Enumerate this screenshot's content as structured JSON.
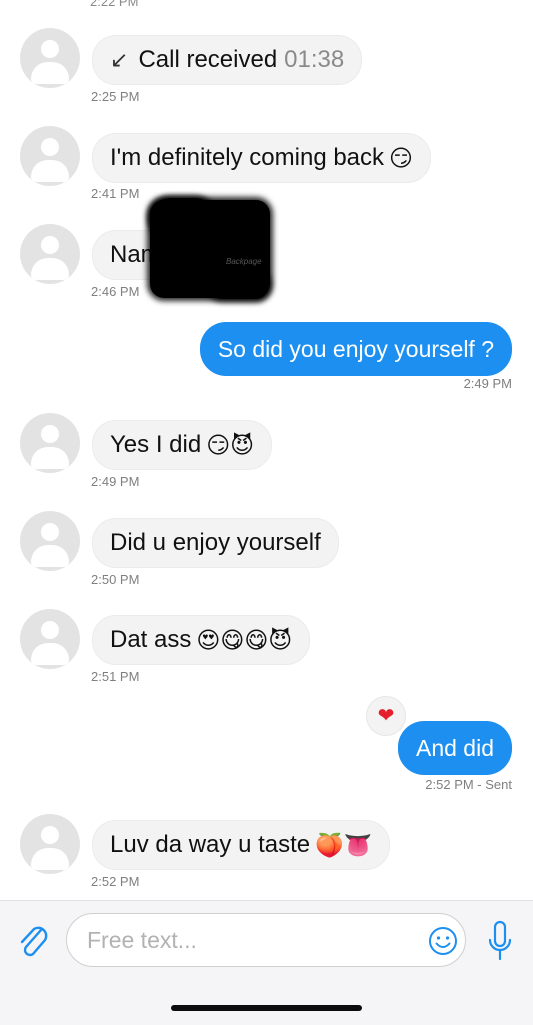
{
  "thread": {
    "top_cut_time": "2:22 PM",
    "messages": [
      {
        "call_label": "Call received",
        "call_duration": "01:38",
        "time": "2:25 PM",
        "call_icon": "arrow-down-left-icon"
      },
      {
        "text": "I'm definitely coming back",
        "emoji": "😏",
        "time": "2:41 PM"
      },
      {
        "text": "Name s",
        "redacted": true,
        "watermark": "Backpage",
        "time": "2:46 PM"
      },
      {
        "text": "So did you enjoy yourself ?",
        "time": "2:49 PM"
      },
      {
        "text": "Yes I did",
        "emoji": "😏😈",
        "time": "2:49 PM"
      },
      {
        "text": "Did u enjoy yourself",
        "time": "2:50 PM"
      },
      {
        "text": "Dat ass",
        "emoji": "😍😋😋😈",
        "time": "2:51 PM"
      },
      {
        "text": "And did",
        "reaction": "❤",
        "time": "2:52 PM - Sent"
      },
      {
        "text": "Luv da way u taste",
        "emoji": "🍑👅",
        "time": "2:52 PM"
      }
    ]
  },
  "composer": {
    "placeholder": "Free text...",
    "icons": [
      "paperclip-icon",
      "smiley-icon",
      "microphone-icon"
    ]
  },
  "colors": {
    "outgoing_bubble": "#1c8ff0",
    "incoming_bubble": "#f3f3f3",
    "timestamp": "#7f7f7f"
  }
}
